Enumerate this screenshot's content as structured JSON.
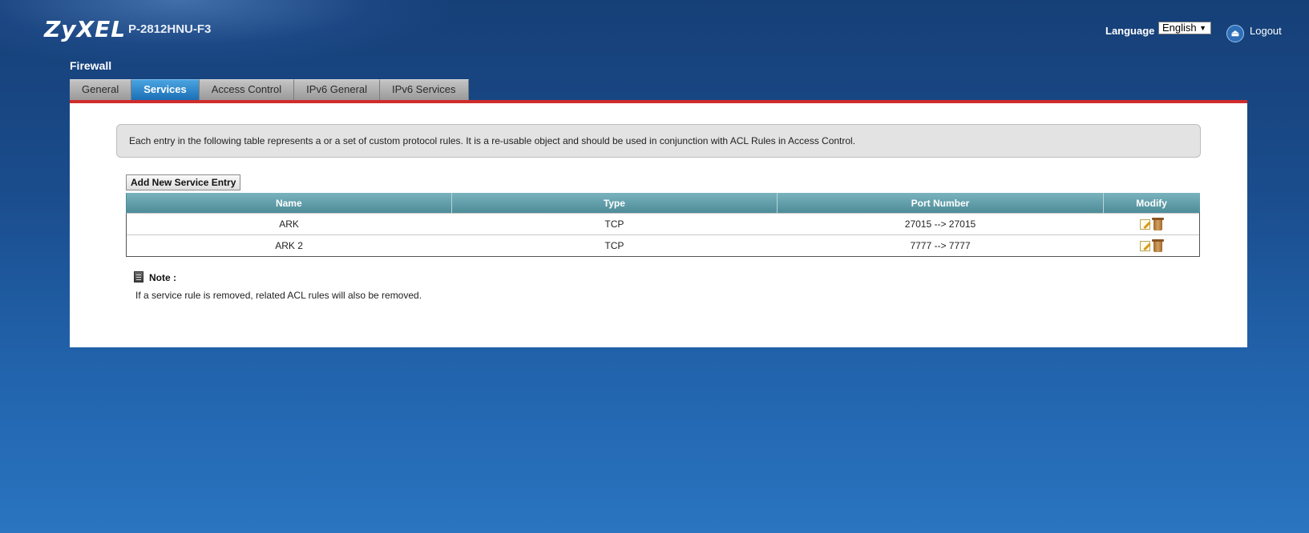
{
  "header": {
    "brand": "ZyXEL",
    "model": "P-2812HNU-F3",
    "language_label": "Language :",
    "language_value": "English",
    "logout_label": "Logout"
  },
  "page": {
    "title": "Firewall"
  },
  "tabs": [
    {
      "label": "General",
      "active": false
    },
    {
      "label": "Services",
      "active": true
    },
    {
      "label": "Access Control",
      "active": false
    },
    {
      "label": "IPv6 General",
      "active": false
    },
    {
      "label": "IPv6 Services",
      "active": false
    }
  ],
  "description": "Each entry in the following table represents a or a set of custom protocol rules. It is a re-usable object and should be used in conjunction with ACL Rules in Access Control.",
  "add_button_label": "Add New Service Entry",
  "table": {
    "headers": [
      "Name",
      "Type",
      "Port Number",
      "Modify"
    ],
    "rows": [
      {
        "name": "ARK",
        "type": "TCP",
        "port": "27015 --> 27015"
      },
      {
        "name": "ARK 2",
        "type": "TCP",
        "port": "7777 --> 7777"
      }
    ]
  },
  "note": {
    "title": "Note :",
    "text": "If a service rule is removed, related ACL rules will also be removed."
  },
  "icons": {
    "logout": "logout-icon",
    "edit": "edit-icon",
    "delete": "trash-icon",
    "note": "note-icon"
  },
  "colors": {
    "accent_red": "#d02c2c",
    "active_tab": "#1b6fb6",
    "table_header": "#5a98a4",
    "background": "#1a4c8c"
  }
}
